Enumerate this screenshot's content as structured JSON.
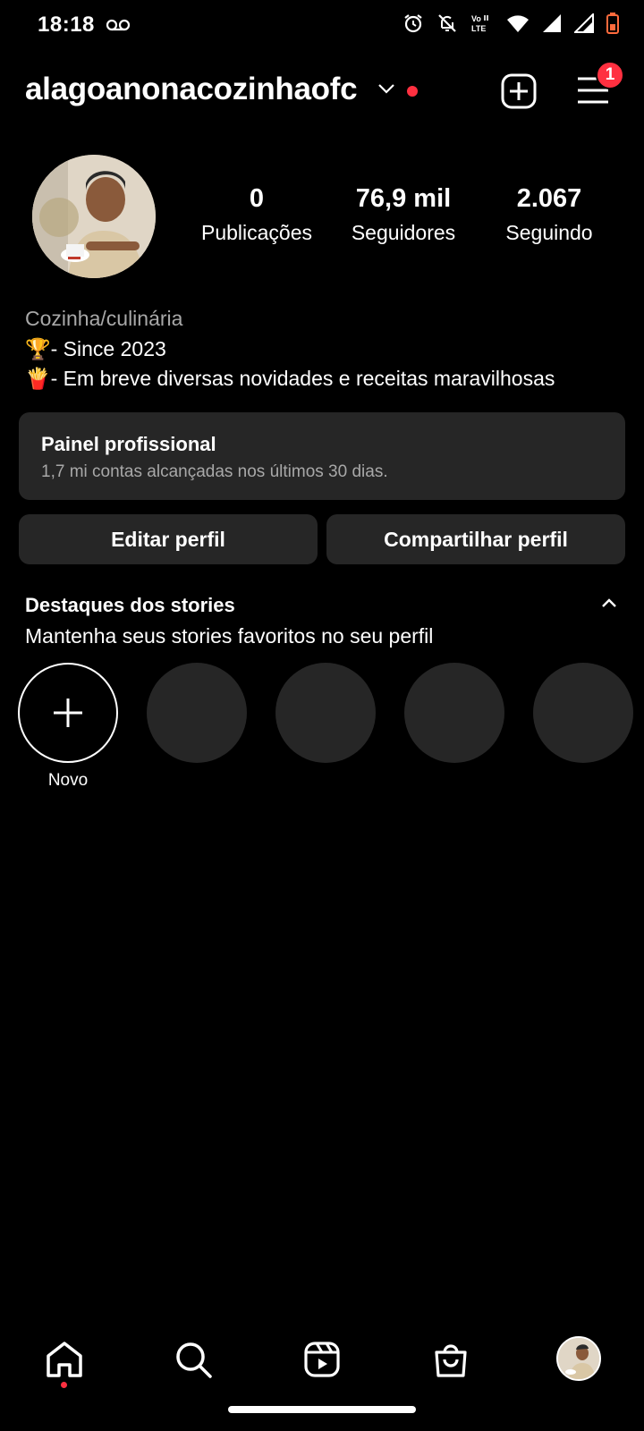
{
  "status_bar": {
    "time": "18:18",
    "icons": [
      "voicemail-icon",
      "alarm-icon",
      "bell-off-icon",
      "volte-icon",
      "wifi-icon",
      "signal-icon",
      "signal-icon",
      "battery-icon"
    ],
    "battery_color": "#ff6b3d"
  },
  "header": {
    "username": "alagoanonacozinhaofc",
    "menu_badge": "1"
  },
  "profile": {
    "posts_count": "0",
    "posts_label": "Publicações",
    "followers_count": "76,9 mil",
    "followers_label": "Seguidores",
    "following_count": "2.067",
    "following_label": "Seguindo",
    "category": "Cozinha/culinária",
    "bio_line1": "🏆- Since 2023",
    "bio_line2": "🍟- Em breve diversas novidades e receitas maravilhosas"
  },
  "dashboard": {
    "title": "Painel profissional",
    "subtitle": "1,7 mi contas alcançadas nos últimos 30 dias."
  },
  "actions": {
    "edit_label": "Editar perfil",
    "share_label": "Compartilhar perfil"
  },
  "highlights": {
    "title": "Destaques dos stories",
    "subtitle": "Mantenha seus stories favoritos no seu perfil",
    "new_label": "Novo"
  },
  "colors": {
    "background": "#000000",
    "surface": "#262626",
    "accent_red": "#ff3040",
    "muted_text": "#a8a8a8"
  }
}
